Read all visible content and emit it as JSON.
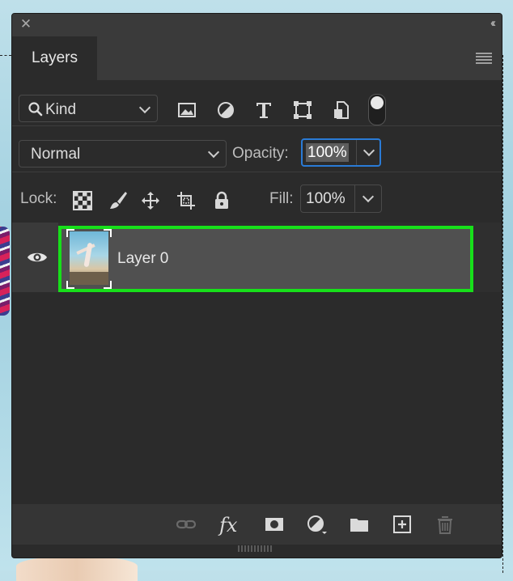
{
  "panel": {
    "close_glyph": "✕",
    "collapse_glyph": "‹‹",
    "tab_label": "Layers"
  },
  "filter": {
    "kind_label": "Kind",
    "icons": [
      "image-filter-icon",
      "adjustment-filter-icon",
      "type-filter-icon",
      "shape-filter-icon",
      "smart-object-filter-icon"
    ],
    "toggle_on": true
  },
  "blend": {
    "mode": "Normal",
    "opacity_label": "Opacity:",
    "opacity_value": "100%"
  },
  "lock": {
    "label": "Lock:",
    "icons": [
      "lock-transparent-pixels-icon",
      "lock-image-pixels-icon",
      "lock-position-icon",
      "prevent-autonest-icon",
      "lock-all-icon"
    ],
    "fill_label": "Fill:",
    "fill_value": "100%"
  },
  "layers": [
    {
      "name": "Layer 0",
      "visible": true,
      "selected": true
    }
  ],
  "bottom": {
    "fx_label": "fx",
    "icons": [
      "link-layers-icon",
      "layer-style-icon",
      "add-mask-icon",
      "adjustment-layer-icon",
      "new-group-icon",
      "new-layer-icon",
      "delete-layer-icon"
    ]
  },
  "colors": {
    "panel_bg": "#2b2b2b",
    "selection_outline": "#17e01a",
    "focus_blue": "#2a7bd6"
  }
}
